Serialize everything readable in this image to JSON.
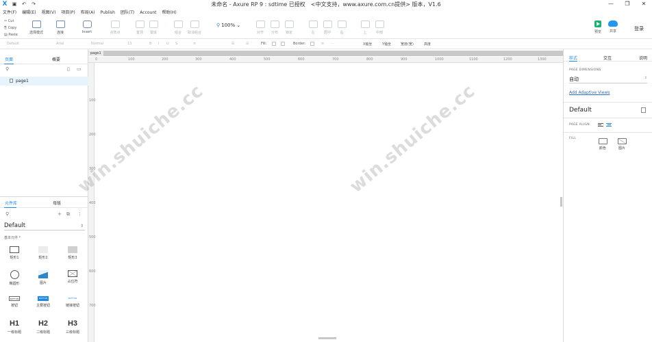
{
  "titlebar": {
    "app_logo": "X",
    "title": "未命名 - Axure RP 9 : sdtime 已授权　<中文支持，www.axure.com.cn提供> 版本，V1.6",
    "minimize": "—",
    "maximize": "❐",
    "close": "✕"
  },
  "menu": [
    "文件(F)",
    "编辑(E)",
    "视图(V)",
    "项目(P)",
    "布局(A)",
    "Publish",
    "团队(T)",
    "Account",
    "帮助(H)"
  ],
  "toolbar": {
    "cut": "Cut",
    "copy": "Copy",
    "paste": "Paste",
    "select_mode": "选择模式",
    "connect": "连接",
    "insert": "Insert",
    "tool_labels": [
      "点阵点",
      "置顶",
      "置底",
      "组合",
      "取消组合",
      "对齐",
      "分布",
      "锁定",
      "左",
      "居中",
      "右",
      "上",
      "中部",
      "下",
      "水平",
      "垂直"
    ],
    "zoom": "100%",
    "preview": "预览",
    "share": "共享",
    "login": "登录"
  },
  "formatbar": {
    "style": "Default",
    "font": "Arial",
    "weight": "Normal",
    "size": "13",
    "fill": "Fill:",
    "border": "Border:",
    "x_label": "X轴坐",
    "y_label": "Y轴坐",
    "w_label": "宽度(宽)",
    "h_label": "高度"
  },
  "left_panel": {
    "tabs": [
      "页面",
      "概要"
    ],
    "page_name": "page1",
    "lib_tabs": [
      "元件库",
      "母版"
    ],
    "library": "Default",
    "section": "基本元件 *",
    "widgets": [
      {
        "label": "矩形1"
      },
      {
        "label": "矩形2"
      },
      {
        "label": "矩形3"
      },
      {
        "label": "椭圆形"
      },
      {
        "label": "图片"
      },
      {
        "label": "占位符"
      },
      {
        "label": "按钮",
        "text": "BUTTON"
      },
      {
        "label": "主要按钮",
        "text": "BUTTON"
      },
      {
        "label": "链接按钮",
        "text": "BUTTON"
      },
      {
        "label": "一级标题",
        "text": "H1"
      },
      {
        "label": "二级标题",
        "text": "H2"
      },
      {
        "label": "三级标题",
        "text": "H3"
      }
    ]
  },
  "canvas": {
    "tab": "page1",
    "ruler_h": [
      "0",
      "100",
      "200",
      "300",
      "400",
      "500",
      "600",
      "700",
      "800",
      "900",
      "1000",
      "1100",
      "1200",
      "1300"
    ],
    "ruler_v": [
      "100",
      "200",
      "300",
      "400",
      "500",
      "600",
      "700"
    ],
    "watermark": "win.shuiche.cc"
  },
  "right_panel": {
    "tabs": [
      "样式",
      "交互",
      "说明"
    ],
    "page_dimensions": "PAGE DIMENSIONS",
    "dimension_value": "自动",
    "adaptive_link": "Add Adaptive Views",
    "style_name": "Default",
    "page_align": "PAGE ALIGN",
    "fill": "FILL",
    "fill_color": "颜色",
    "fill_image": "图片"
  }
}
